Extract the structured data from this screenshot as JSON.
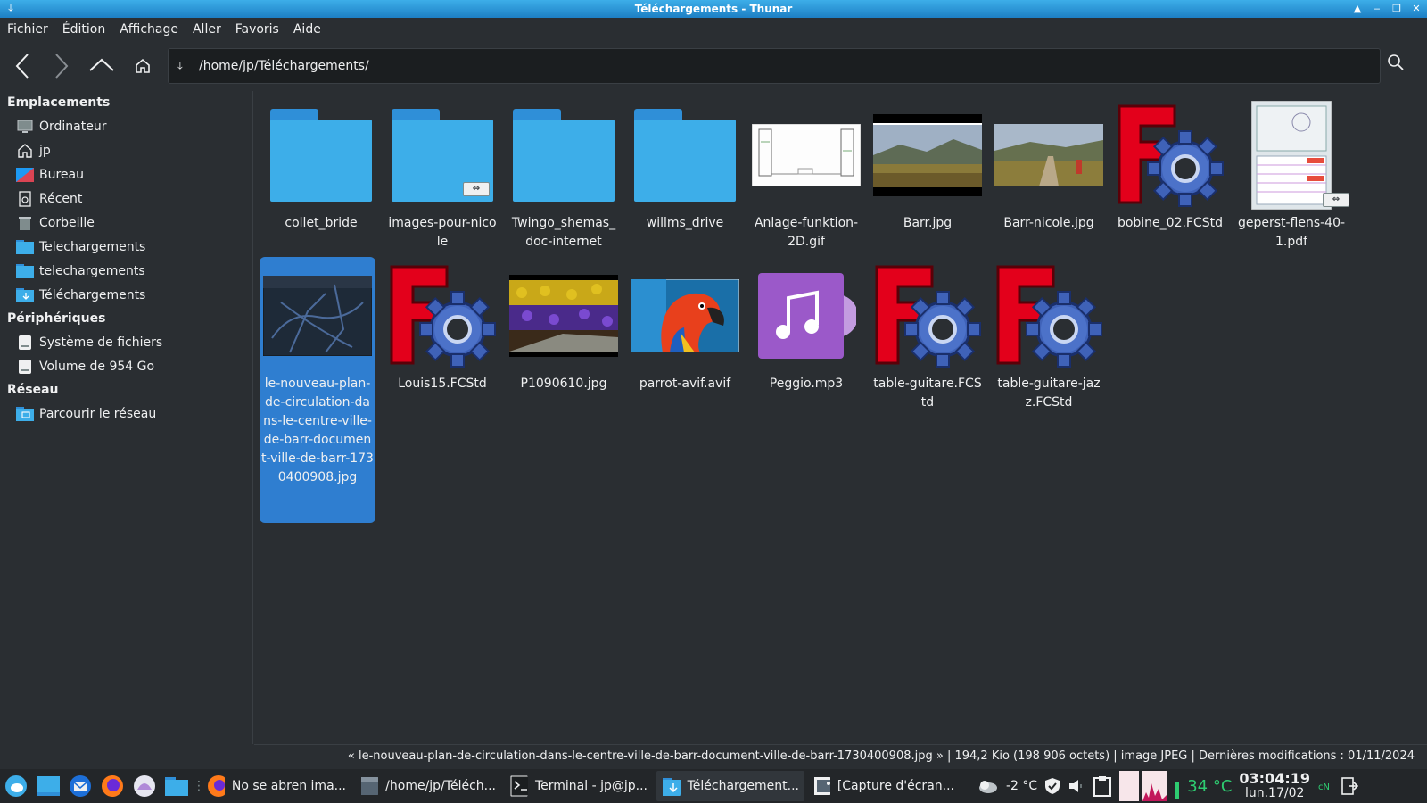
{
  "window": {
    "title": "Téléchargements - Thunar"
  },
  "menu": [
    "Fichier",
    "Édition",
    "Affichage",
    "Aller",
    "Favoris",
    "Aide"
  ],
  "address": {
    "path": "/home/jp/Téléchargements/"
  },
  "sidebar": {
    "sections": [
      {
        "title": "Emplacements",
        "items": [
          {
            "label": "Ordinateur",
            "icon": "computer-icon"
          },
          {
            "label": "jp",
            "icon": "home-icon"
          },
          {
            "label": "Bureau",
            "icon": "desktop-icon"
          },
          {
            "label": "Récent",
            "icon": "recent-icon"
          },
          {
            "label": "Corbeille",
            "icon": "trash-icon"
          },
          {
            "label": "Telechargements",
            "icon": "folder-icon"
          },
          {
            "label": "telechargements",
            "icon": "folder-icon"
          },
          {
            "label": "Téléchargements",
            "icon": "download-folder-icon"
          }
        ]
      },
      {
        "title": "Périphériques",
        "items": [
          {
            "label": "Système de fichiers",
            "icon": "drive-icon"
          },
          {
            "label": "Volume de 954 Go",
            "icon": "drive-icon"
          }
        ]
      },
      {
        "title": "Réseau",
        "items": [
          {
            "label": "Parcourir le réseau",
            "icon": "network-icon"
          }
        ]
      }
    ]
  },
  "files": [
    {
      "name": "collet_bride",
      "kind": "folder"
    },
    {
      "name": "images-pour-nicole",
      "kind": "folder-link"
    },
    {
      "name": "Twingo_shemas_doc-internet",
      "kind": "folder"
    },
    {
      "name": "willms_drive",
      "kind": "folder"
    },
    {
      "name": "Anlage-funktion-2D.gif",
      "kind": "image-drawing"
    },
    {
      "name": "Barr.jpg",
      "kind": "image-landscape"
    },
    {
      "name": "Barr-nicole.jpg",
      "kind": "image-landscape2"
    },
    {
      "name": "bobine_02.FCStd",
      "kind": "freecad"
    },
    {
      "name": "geperst-flens-40-1.pdf",
      "kind": "pdf-link"
    },
    {
      "name": "le-nouveau-plan-de-circulation-dans-le-centre-ville-de-barr-document-ville-de-barr-1730400908.jpg",
      "kind": "image-map",
      "selected": true
    },
    {
      "name": "Louis15.FCStd",
      "kind": "freecad"
    },
    {
      "name": "P1090610.jpg",
      "kind": "image-flowers"
    },
    {
      "name": "parrot-avif.avif",
      "kind": "image-parrot"
    },
    {
      "name": "Peggio.mp3",
      "kind": "audio"
    },
    {
      "name": "table-guitare.FCStd",
      "kind": "freecad"
    },
    {
      "name": "table-guitare-jazz.FCStd",
      "kind": "freecad"
    }
  ],
  "status": {
    "text": "« le-nouveau-plan-de-circulation-dans-le-centre-ville-de-barr-document-ville-de-barr-1730400908.jpg »  |  194,2 Kio (198 906 octets)  |  image JPEG  |  Dernières modifications : 01/11/2024"
  },
  "taskbar": {
    "tasks": [
      {
        "label": "No se abren ima...",
        "icon": "firefox-icon"
      },
      {
        "label": "/home/jp/Téléch...",
        "icon": "folder-window-icon"
      },
      {
        "label": "Terminal - jp@jp...",
        "icon": "terminal-icon"
      },
      {
        "label": "Téléchargement...",
        "icon": "download-folder-icon"
      },
      {
        "label": "[Capture d'écran...",
        "icon": "screenshot-icon"
      }
    ],
    "weather": "-2 °C",
    "cpu_temp": "34 °C",
    "time": "03:04:19",
    "date": "lun.17/02"
  }
}
